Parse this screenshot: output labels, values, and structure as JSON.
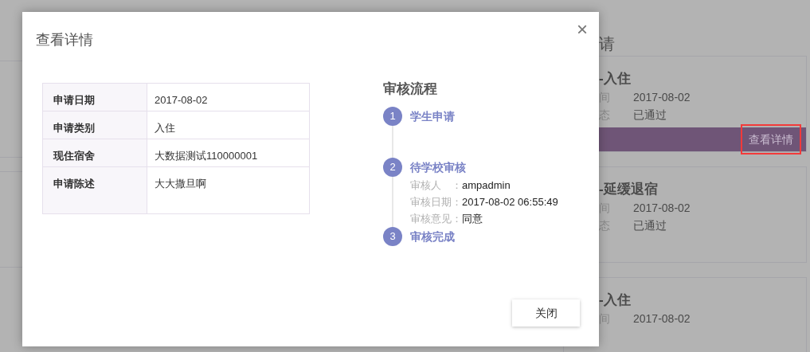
{
  "background": {
    "heading": "请",
    "cards": [
      {
        "title": "-入住",
        "rows": [
          {
            "label": "间",
            "value": "2017-08-02"
          },
          {
            "label": "态",
            "value": "已通过"
          }
        ],
        "action": "查看详情",
        "highlighted": true
      },
      {
        "title": "-延缓退宿",
        "rows": [
          {
            "label": "间",
            "value": "2017-08-02"
          },
          {
            "label": "态",
            "value": "已通过"
          }
        ]
      },
      {
        "title": "-入住",
        "rows": [
          {
            "label": "间",
            "value": "2017-08-02"
          }
        ]
      }
    ]
  },
  "dialog": {
    "title": "查看详情",
    "close_icon": "×",
    "details": [
      {
        "label": "申请日期",
        "value": "2017-08-02"
      },
      {
        "label": "申请类别",
        "value": "入住"
      },
      {
        "label": "现住宿舍",
        "value": "大数据测试110000001"
      },
      {
        "label": "申请陈述",
        "value": "大大撒旦啊"
      }
    ],
    "process": {
      "title": "审核流程",
      "steps": [
        {
          "number": "1",
          "title": "学生申请"
        },
        {
          "number": "2",
          "title": "待学校审核",
          "details": [
            {
              "label": "审核人　：",
              "value": "ampadmin"
            },
            {
              "label": "审核日期：",
              "value": "2017-08-02 06:55:49"
            },
            {
              "label": "审核意见：",
              "value": "同意"
            }
          ]
        },
        {
          "number": "3",
          "title": "审核完成"
        }
      ]
    },
    "buttons": [
      "关闭"
    ]
  }
}
